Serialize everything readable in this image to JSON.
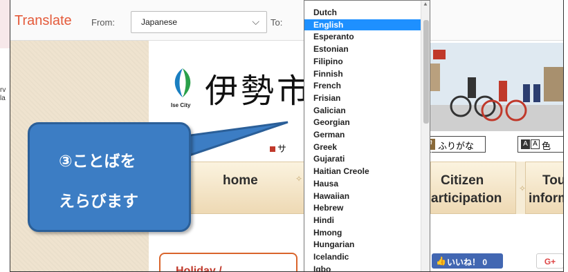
{
  "left_snippet": [
    "rv",
    "la"
  ],
  "translate_bar": {
    "title": "Translate",
    "from_label": "From:",
    "from_value": "Japanese",
    "to_label": "To:"
  },
  "language_list": {
    "items": [
      "Dutch",
      "English",
      "Esperanto",
      "Estonian",
      "Filipino",
      "Finnish",
      "French",
      "Frisian",
      "Galician",
      "Georgian",
      "German",
      "Greek",
      "Gujarati",
      "Haitian Creole",
      "Hausa",
      "Hawaiian",
      "Hebrew",
      "Hindi",
      "Hmong",
      "Hungarian",
      "Icelandic",
      "Igbo"
    ],
    "selected": "English",
    "selection_color": "#1e90ff"
  },
  "site": {
    "logo_subtitle": "Ise City",
    "logo_kanji": "伊勢市",
    "sa_link": "サ",
    "furigana_mark": "伊勢",
    "furigana_label": "ふりがな",
    "color_label": "色",
    "color_a1": "A",
    "color_a2": "A",
    "nav": [
      "home",
      "Citizen",
      "articipation",
      "Tou",
      "inform"
    ],
    "holiday": "Holiday /",
    "like_label": "いいね！ 0",
    "gplus": "G+"
  },
  "callout": {
    "line1": "③ことばを",
    "line2": "えらびます",
    "color": "#3c7dc4"
  }
}
